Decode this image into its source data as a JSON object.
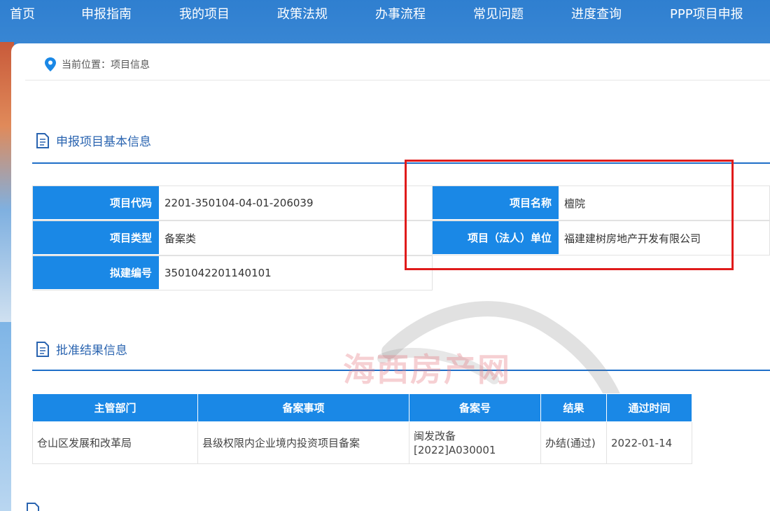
{
  "nav": [
    "首页",
    "申报指南",
    "我的项目",
    "政策法规",
    "办事流程",
    "常见问题",
    "进度查询",
    "PPP项目申报"
  ],
  "breadcrumb": {
    "prefix": "当前位置：",
    "current": "项目信息"
  },
  "basic_info": {
    "title": "申报项目基本信息",
    "project_code_label": "项目代码",
    "project_code": "2201-350104-04-01-206039",
    "project_type_label": "项目类型",
    "project_type": "备案类",
    "draft_no_label": "拟建编号",
    "draft_no": "3501042201140101",
    "project_name_label": "项目名称",
    "project_name": "檀院",
    "legal_unit_label": "项目（法人）单位",
    "legal_unit": "福建建树房地产开发有限公司"
  },
  "approval": {
    "title": "批准结果信息",
    "headers": [
      "主管部门",
      "备案事项",
      "备案号",
      "结果",
      "通过时间"
    ],
    "row": {
      "dept": "仓山区发展和改革局",
      "matter": "县级权限内企业境内投资项目备案",
      "number": "闽发改备[2022]A030001",
      "result": "办结(通过)",
      "time": "2022-01-14"
    }
  },
  "watermark": "海西房产网",
  "colors": {
    "nav_bg": "#2f7fd0",
    "label_bg": "#1a88e6",
    "accent": "#1f6fc8",
    "highlight": "#e01b1b"
  },
  "icons": [
    "location-pin-icon",
    "document-icon"
  ]
}
